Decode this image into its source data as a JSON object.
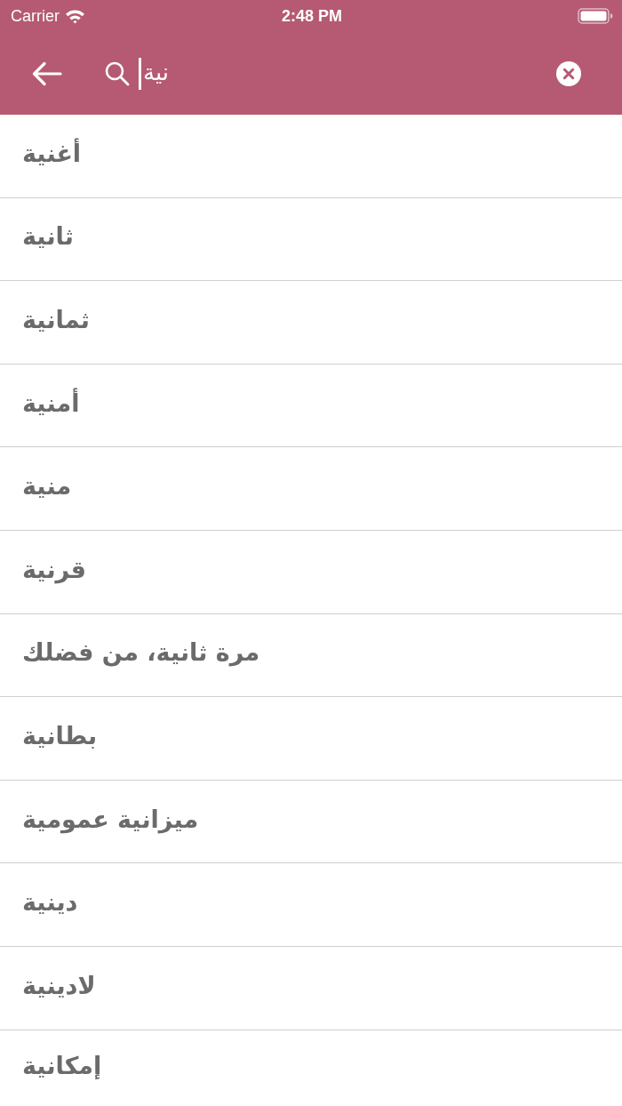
{
  "status_bar": {
    "carrier": "Carrier",
    "time": "2:48 PM"
  },
  "search": {
    "value": "نية",
    "focused": true
  },
  "results": [
    {
      "text": "أغنية"
    },
    {
      "text": "ثانية"
    },
    {
      "text": "ثمانية"
    },
    {
      "text": "أمنية"
    },
    {
      "text": "منية"
    },
    {
      "text": "قرنية"
    },
    {
      "text": "مرة ثانية، من فضلك"
    },
    {
      "text": "بطانية"
    },
    {
      "text": "ميزانية عمومية"
    },
    {
      "text": "دينية"
    },
    {
      "text": "لادينية"
    },
    {
      "text": "إمكانية"
    }
  ]
}
